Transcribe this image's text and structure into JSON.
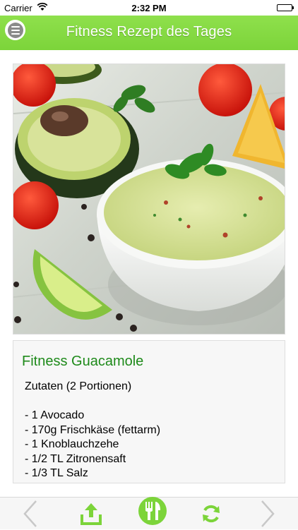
{
  "status_bar": {
    "carrier": "Carrier",
    "time": "2:32 PM"
  },
  "nav": {
    "title": "Fitness Rezept des Tages"
  },
  "recipe": {
    "title": "Fitness Guacamole",
    "ingredients_heading": "Zutaten (2 Portionen)",
    "ingredients": [
      "- 1 Avocado",
      "- 170g Frischkäse (fettarm)",
      "- 1 Knoblauchzehe",
      "- 1/2 TL Zitronensaft",
      "- 1/3 TL Salz"
    ]
  },
  "toolbar": {
    "icons": [
      "chevron-left-icon",
      "share-icon",
      "fork-knife-icon",
      "refresh-icon",
      "chevron-right-icon"
    ]
  },
  "colors": {
    "accent_green": "#7cd43a",
    "title_green": "#1e8a1a",
    "disabled_gray": "#c8c8c8"
  }
}
